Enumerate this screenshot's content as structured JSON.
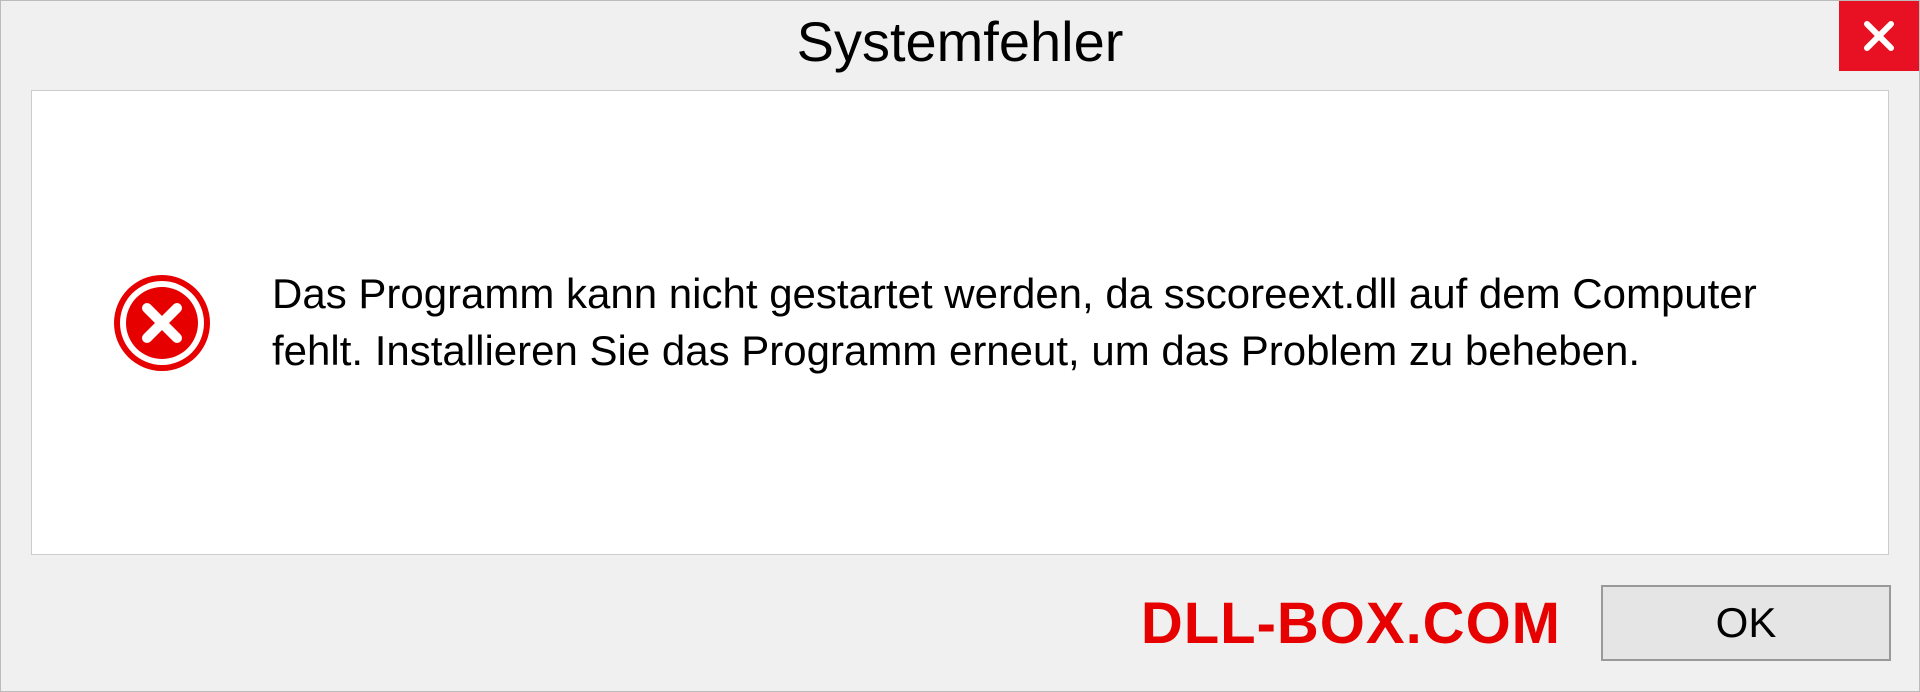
{
  "dialog": {
    "title": "Systemfehler",
    "message": "Das Programm kann nicht gestartet werden, da sscoreext.dll auf dem Computer fehlt. Installieren Sie das Programm erneut, um das Problem zu beheben.",
    "ok_label": "OK"
  },
  "watermark": "DLL-BOX.COM"
}
